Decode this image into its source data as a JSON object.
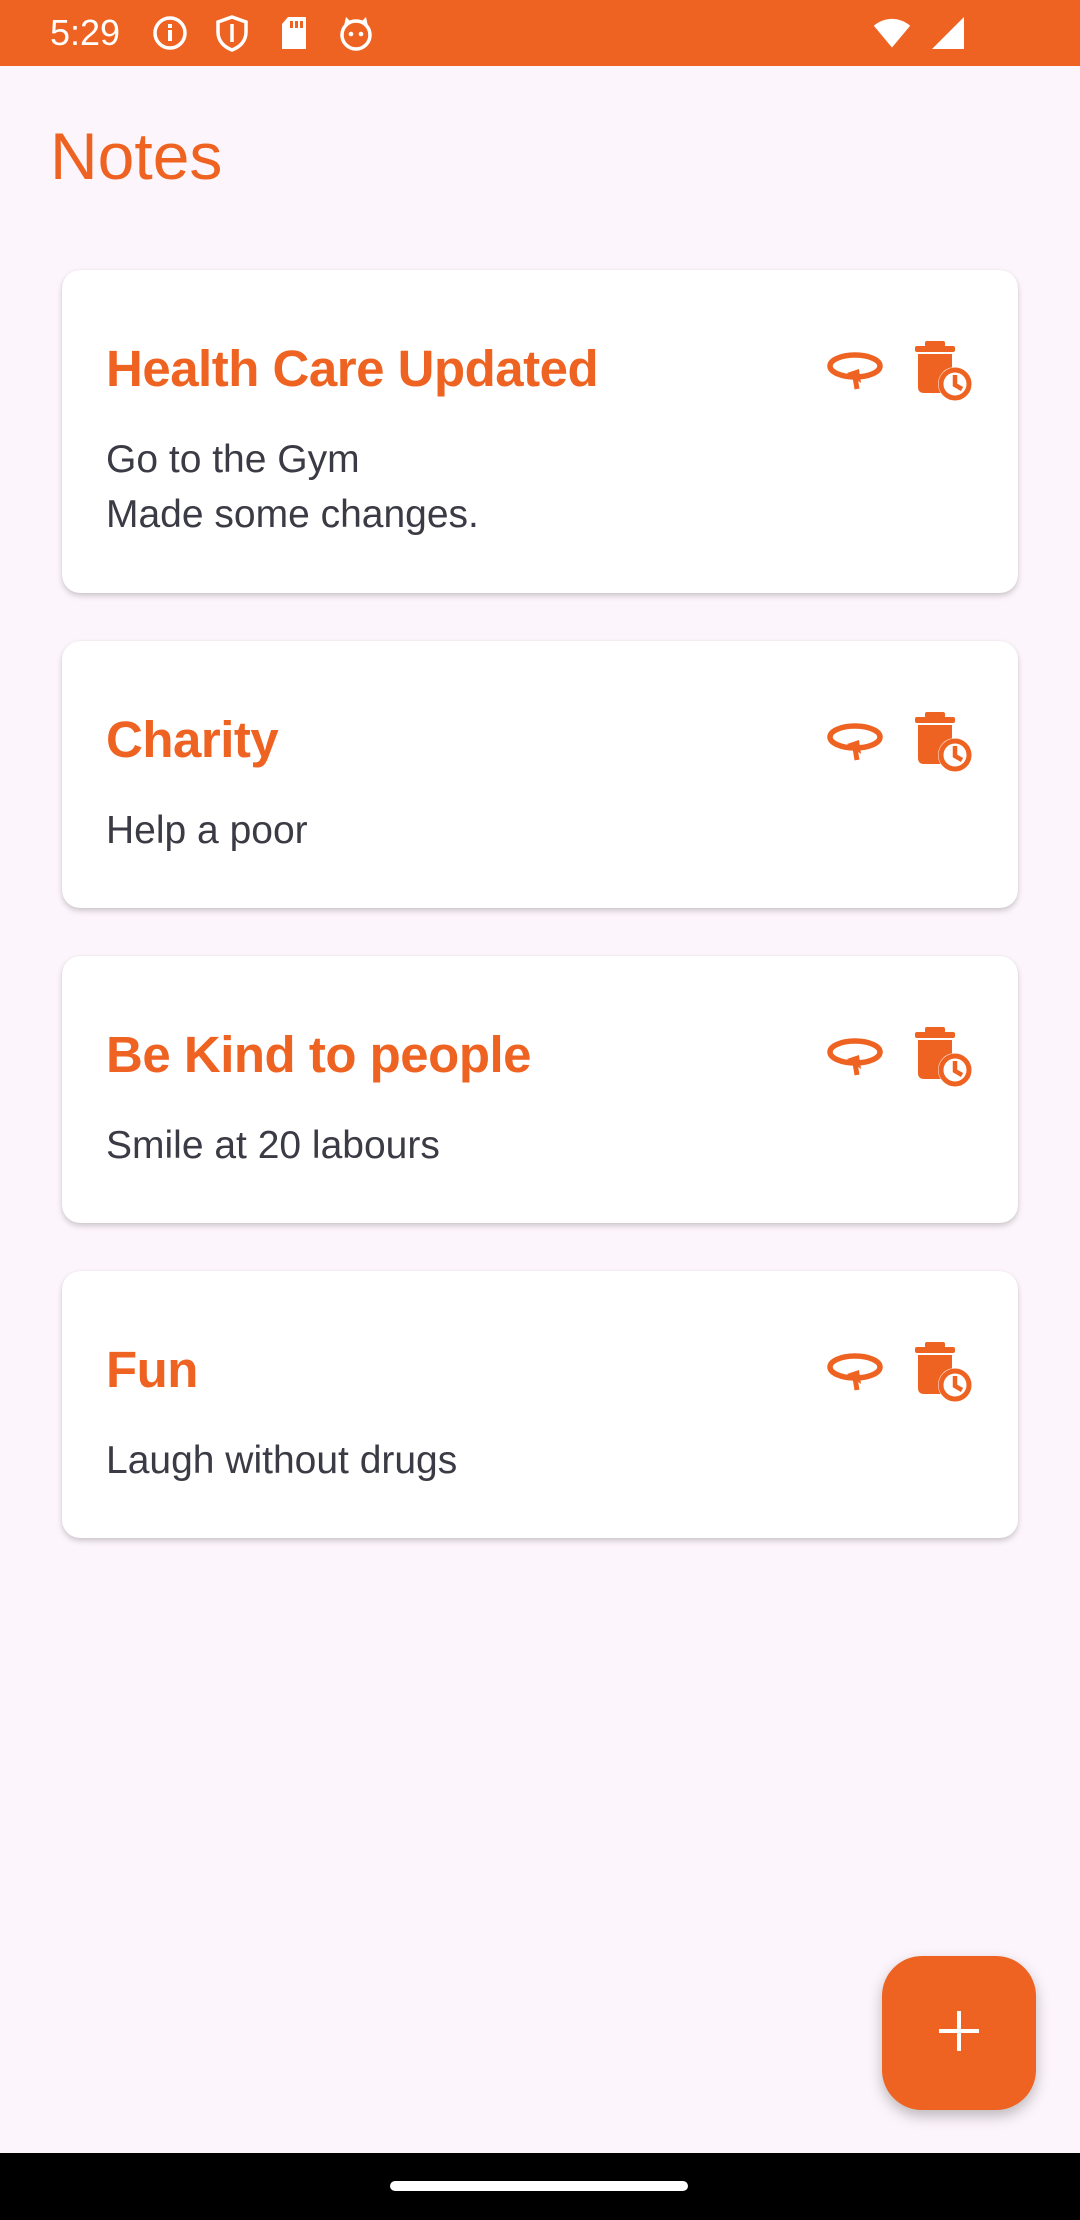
{
  "status_bar": {
    "time": "5:29",
    "left_icons": [
      "info-icon",
      "shield-icon",
      "sd-card-icon",
      "cat-icon"
    ],
    "right_icons": [
      "wifi-icon",
      "cell-signal-icon"
    ]
  },
  "header": {
    "title": "Notes"
  },
  "notes": [
    {
      "title": "Health Care Updated",
      "body": "Go to the Gym\nMade some changes."
    },
    {
      "title": "Charity",
      "body": "Help a poor"
    },
    {
      "title": "Be Kind to people",
      "body": "Smile at 20 labours"
    },
    {
      "title": "Fun",
      "body": "Laugh without drugs"
    }
  ],
  "note_action_icons": [
    "edit-loop-icon",
    "delete-schedule-icon"
  ],
  "fab": {
    "icon": "plus-icon"
  },
  "colors": {
    "accent": "#EF6322",
    "background": "#FCF5FB",
    "card": "#FFFFFF",
    "body_text": "#3B3B45"
  }
}
